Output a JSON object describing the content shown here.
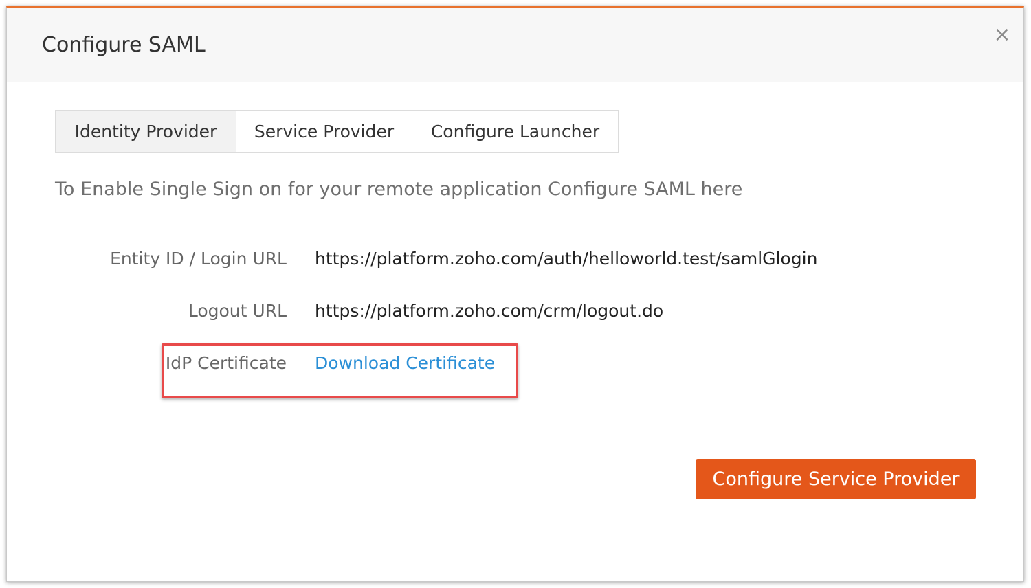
{
  "dialog": {
    "title": "Configure SAML",
    "close_glyph": "×",
    "accent_color": "#e8722e"
  },
  "tabs": [
    {
      "label": "Identity Provider",
      "active": true
    },
    {
      "label": "Service Provider",
      "active": false
    },
    {
      "label": "Configure Launcher",
      "active": false
    }
  ],
  "intro": "To Enable Single Sign on for your remote application Configure SAML here",
  "fields": {
    "entity_id": {
      "label": "Entity ID / Login URL",
      "value": "https://platform.zoho.com/auth/helloworld.test/samlGlogin"
    },
    "logout": {
      "label": "Logout URL",
      "value": "https://platform.zoho.com/crm/logout.do"
    },
    "certificate": {
      "label": "IdP Certificate",
      "link": "Download Certificate"
    }
  },
  "footer": {
    "primary_button": "Configure Service Provider",
    "primary_color": "#e4571a"
  },
  "colors": {
    "link": "#2b8fd6",
    "highlight_border": "#e84a4a"
  }
}
